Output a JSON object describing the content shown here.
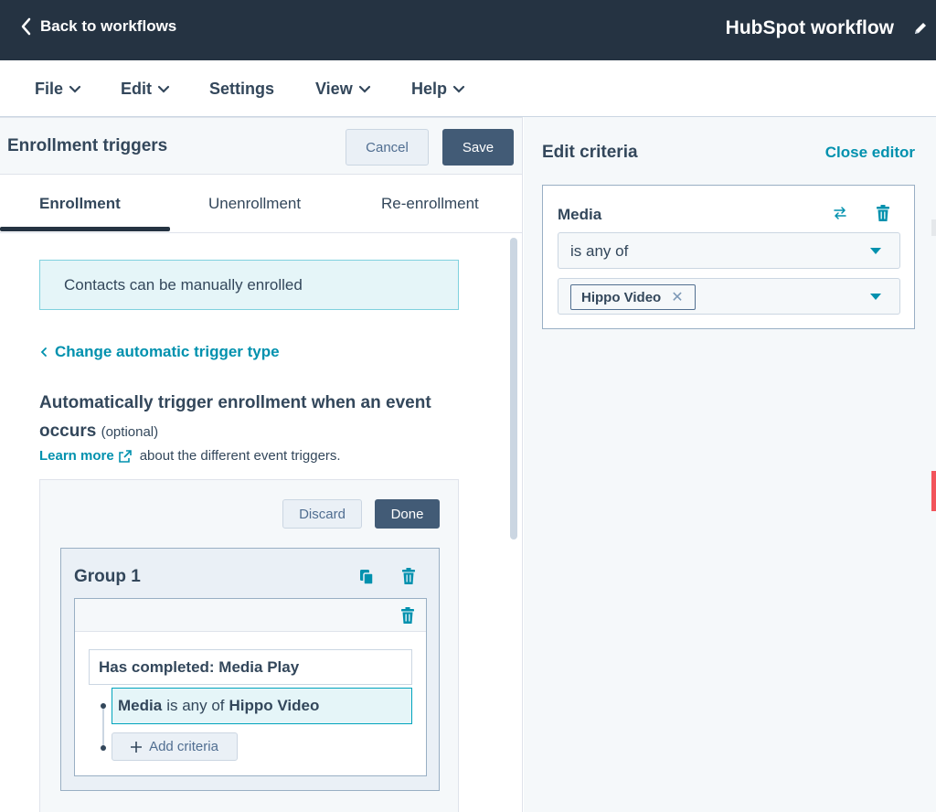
{
  "topbar": {
    "back_label": "Back to workflows",
    "workflow_title": "HubSpot workflow"
  },
  "menu": {
    "items": [
      {
        "label": "File",
        "has_dropdown": true
      },
      {
        "label": "Edit",
        "has_dropdown": true
      },
      {
        "label": "Settings",
        "has_dropdown": false
      },
      {
        "label": "View",
        "has_dropdown": true
      },
      {
        "label": "Help",
        "has_dropdown": true
      }
    ]
  },
  "left": {
    "title": "Enrollment triggers",
    "cancel_label": "Cancel",
    "save_label": "Save",
    "tabs": [
      {
        "label": "Enrollment",
        "active": true
      },
      {
        "label": "Unenrollment",
        "active": false
      },
      {
        "label": "Re-enrollment",
        "active": false
      }
    ],
    "info_text": "Contacts can be manually enrolled",
    "change_link": "Change automatic trigger type",
    "heading": "Automatically trigger enrollment when an event occurs",
    "heading_optional": "(optional)",
    "learn_more": "Learn more",
    "learn_more_suffix": "about the different event triggers.",
    "discard_label": "Discard",
    "done_label": "Done",
    "group_title": "Group 1",
    "event_label": "Has completed: Media Play",
    "filter": {
      "property": "Media",
      "operator": "is any of",
      "value": "Hippo Video"
    },
    "add_criteria_label": "Add criteria"
  },
  "right": {
    "title": "Edit criteria",
    "close_label": "Close editor",
    "criteria_label": "Media",
    "operator_value": "is any of",
    "selected_values": [
      "Hippo Video"
    ]
  },
  "colors": {
    "topbar_bg": "#253342",
    "primary_button": "#425b76",
    "link": "#0091ae",
    "info_bg": "#e5f5f8",
    "text": "#33475b"
  }
}
